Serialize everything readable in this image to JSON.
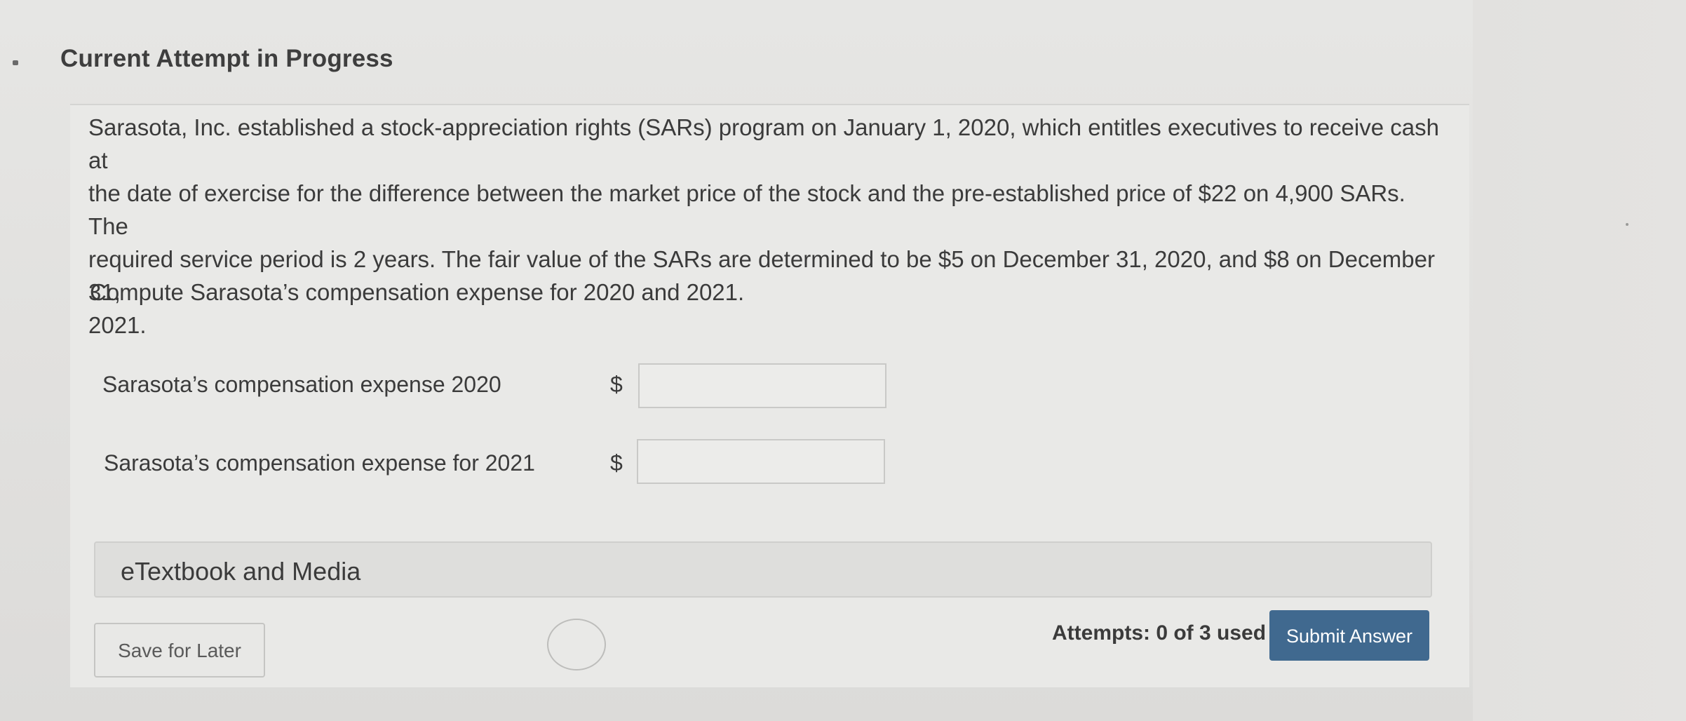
{
  "header": {
    "title": "Current Attempt in Progress"
  },
  "problem": {
    "lines": [
      "Sarasota, Inc. established a stock-appreciation rights (SARs) program on January 1, 2020, which entitles executives to receive cash at",
      "the date of exercise for the difference between the market price of the stock and the pre-established price of $22 on 4,900 SARs. The",
      "required service period is 2 years. The fair value of the SARs are determined to be $5 on December 31, 2020, and $8 on December 31,",
      "2021."
    ],
    "question": "Compute Sarasota’s compensation expense for 2020 and 2021."
  },
  "answers": [
    {
      "label": "Sarasota’s compensation expense 2020",
      "currency": "$",
      "value": ""
    },
    {
      "label": "Sarasota’s compensation expense for 2021",
      "currency": "$",
      "value": ""
    }
  ],
  "resources": {
    "etextbook_label": "eTextbook and Media"
  },
  "footer": {
    "save_label": "Save for Later",
    "attempts_text": "Attempts: 0 of 3 used",
    "submit_label": "Submit Answer"
  },
  "colors": {
    "submit_bg": "#40698f",
    "text": "#3b3b3b"
  }
}
